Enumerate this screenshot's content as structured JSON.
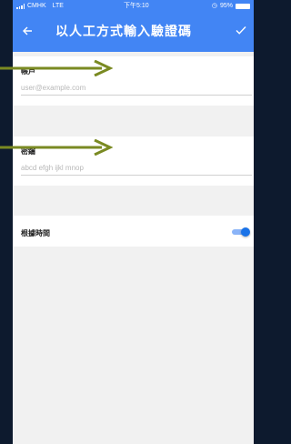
{
  "status_bar": {
    "carrier": "CMHK",
    "network": "LTE",
    "time": "下午5:10",
    "battery": "95%"
  },
  "app_bar": {
    "title": "以人工方式輸入驗證碼",
    "back_icon": "arrow-left-icon",
    "confirm_icon": "check-icon"
  },
  "account": {
    "label": "帳戶",
    "placeholder": "user@example.com"
  },
  "key": {
    "label": "密鑰",
    "placeholder": "abcd efgh ijkl mnop"
  },
  "time_based": {
    "label": "根據時間",
    "enabled": true
  },
  "colors": {
    "appbar": "#4285f4",
    "arrow": "#7a8a22",
    "toggle_on": "#1a73e8"
  }
}
